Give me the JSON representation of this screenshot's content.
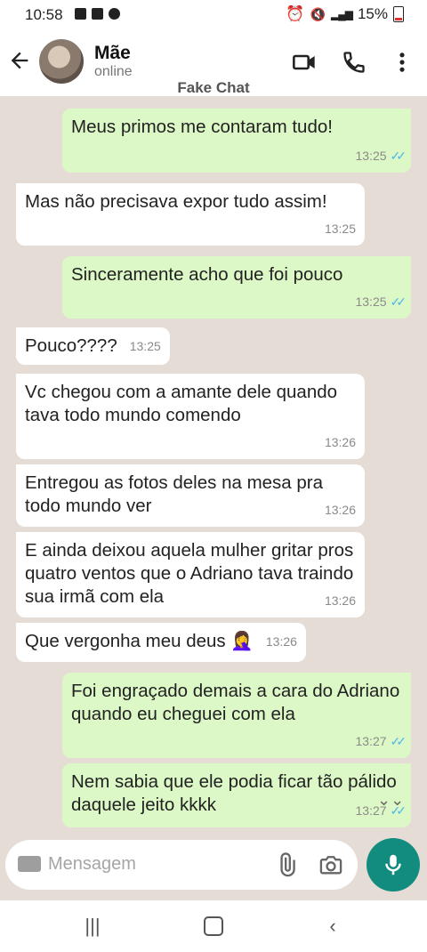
{
  "status_bar": {
    "time": "10:58",
    "battery": "15%"
  },
  "header": {
    "contact_name": "Mãe",
    "contact_status": "online",
    "overlay_label": "Fake Chat"
  },
  "messages": [
    {
      "dir": "out",
      "text": "Meus primos me contaram tudo!",
      "time": "13:25",
      "read": true
    },
    {
      "dir": "in",
      "text": "Mas não precisava expor tudo assim!",
      "time": "13:25"
    },
    {
      "dir": "out",
      "text": "Sinceramente acho que foi pouco",
      "time": "13:25",
      "read": true
    },
    {
      "dir": "in",
      "text": "Pouco????",
      "time": "13:25"
    },
    {
      "dir": "in",
      "text": "Vc chegou com a amante dele quando tava todo mundo comendo",
      "time": "13:26"
    },
    {
      "dir": "in",
      "text": "Entregou as fotos deles na mesa pra todo mundo ver",
      "time": "13:26"
    },
    {
      "dir": "in",
      "text": "E ainda deixou aquela mulher gritar pros quatro ventos que o Adriano tava traindo sua irmã com ela",
      "time": "13:26"
    },
    {
      "dir": "in",
      "text": "Que vergonha meu deus 🤦‍♀️",
      "time": "13:26"
    },
    {
      "dir": "out",
      "text": "Foi engraçado demais a cara do Adriano quando eu cheguei com ela",
      "time": "13:27",
      "read": true
    },
    {
      "dir": "out",
      "text": "Nem sabia que ele podia ficar tão pálido daquele jeito kkkk",
      "time": "13:27",
      "read": true
    }
  ],
  "composer": {
    "placeholder": "Mensagem"
  },
  "colors": {
    "outgoing_bubble": "#dcf8c6",
    "incoming_bubble": "#ffffff",
    "accent": "#128c7e",
    "read_ticks": "#4fb6ec"
  }
}
